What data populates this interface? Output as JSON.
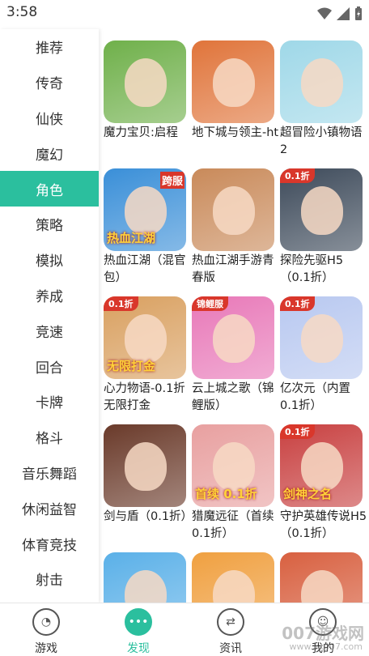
{
  "status_bar": {
    "time": "3:58"
  },
  "sidebar": {
    "items": [
      {
        "label": "推荐"
      },
      {
        "label": "传奇"
      },
      {
        "label": "仙侠"
      },
      {
        "label": "魔幻"
      },
      {
        "label": "角色",
        "active": true
      },
      {
        "label": "策略"
      },
      {
        "label": "模拟"
      },
      {
        "label": "养成"
      },
      {
        "label": "竞速"
      },
      {
        "label": "回合"
      },
      {
        "label": "卡牌"
      },
      {
        "label": "格斗"
      },
      {
        "label": "音乐舞蹈"
      },
      {
        "label": "休闲益智"
      },
      {
        "label": "体育竞技"
      },
      {
        "label": "射击"
      }
    ]
  },
  "apps": [
    {
      "name": "魔力宝贝:启程",
      "color": "#6fb04a",
      "badge": ""
    },
    {
      "name": "地下城与领主-ht",
      "color": "#e0743a",
      "badge": ""
    },
    {
      "name": "超冒险小镇物语2",
      "color": "#9fd8e8",
      "badge": ""
    },
    {
      "name": "热血江湖（混官包）",
      "color": "#3a8fd8",
      "badge": "",
      "art_text": "热血江湖",
      "art_tag": "跨服"
    },
    {
      "name": "热血江湖手游青春版",
      "color": "#c98a5a",
      "badge": ""
    },
    {
      "name": "探险先驱H5（0.1折）",
      "color": "#3d4a5a",
      "badge": "0.1折"
    },
    {
      "name": "心力物语-0.1折无限打金",
      "color": "#d9a060",
      "badge": "0.1折",
      "art_text": "无限打金"
    },
    {
      "name": "云上城之歌（锦鲤版）",
      "color": "#e878b8",
      "badge": "锦鲤服"
    },
    {
      "name": "亿次元（内置0.1折）",
      "color": "#b8c8f0",
      "badge": "0.1折"
    },
    {
      "name": "剑与盾（0.1折）",
      "color": "#6a3a2a",
      "badge": ""
    },
    {
      "name": "猎魔远征（首续0.1折）",
      "color": "#e8a0a0",
      "badge": "",
      "art_text": "首续 0.1折"
    },
    {
      "name": "守护英雄传说H5（0.1折）",
      "color": "#c84040",
      "badge": "0.1折",
      "art_text": "剑神之名"
    },
    {
      "name": "",
      "color": "#5ab0e8",
      "badge": ""
    },
    {
      "name": "",
      "color": "#f0a040",
      "badge": ""
    },
    {
      "name": "",
      "color": "#d86040",
      "badge": ""
    }
  ],
  "tabbar": {
    "tabs": [
      {
        "label": "游戏",
        "glyph": "◔"
      },
      {
        "label": "发现",
        "glyph": "•••",
        "active": true
      },
      {
        "label": "资讯",
        "glyph": "⇄"
      },
      {
        "label": "我的",
        "glyph": "☺"
      }
    ]
  },
  "watermark": {
    "main": "007游戏网",
    "sub": "www.yx007.com"
  }
}
